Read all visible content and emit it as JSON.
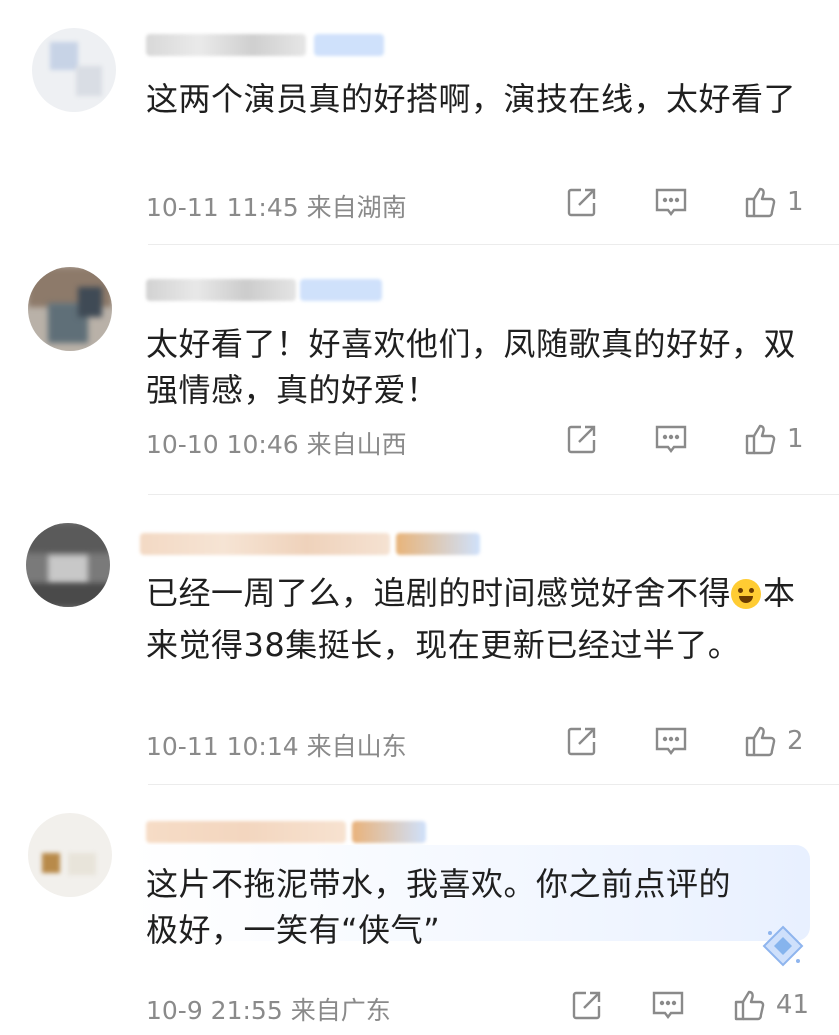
{
  "comments": [
    {
      "text": "这两个演员真的好搭啊，演技在线，太好看了",
      "time": "10-11 11:45",
      "location": "来自湖南",
      "likes": "1",
      "share_icon": "share-icon",
      "reply_icon": "comment-icon",
      "like_icon": "thumbs-up-icon"
    },
    {
      "text": "太好看了！好喜欢他们，凤随歌真的好好，双强情感，真的好爱！",
      "time": "10-10 10:46",
      "location": "来自山西",
      "likes": "1"
    },
    {
      "text_before_emoji": "已经一周了么，追剧的时间感觉好舍不得",
      "emoji": "laughing-tears-emoji",
      "text_after_emoji": "本来觉得38集挺长，现在更新已经过半了。",
      "time": "10-11 10:14",
      "location": "来自山东",
      "likes": "2"
    },
    {
      "text": "这片不拖泥带水，我喜欢。你之前点评的极好，一笑有“侠气”",
      "time": "10-9 21:55",
      "location": "来自广东",
      "likes": "41",
      "highlight_color": "#e8f0ff"
    }
  ],
  "colors": {
    "text": "#1f1f1f",
    "meta": "#8a8a8a",
    "icon": "#8a8a8a",
    "accent": "#4a90e2"
  }
}
